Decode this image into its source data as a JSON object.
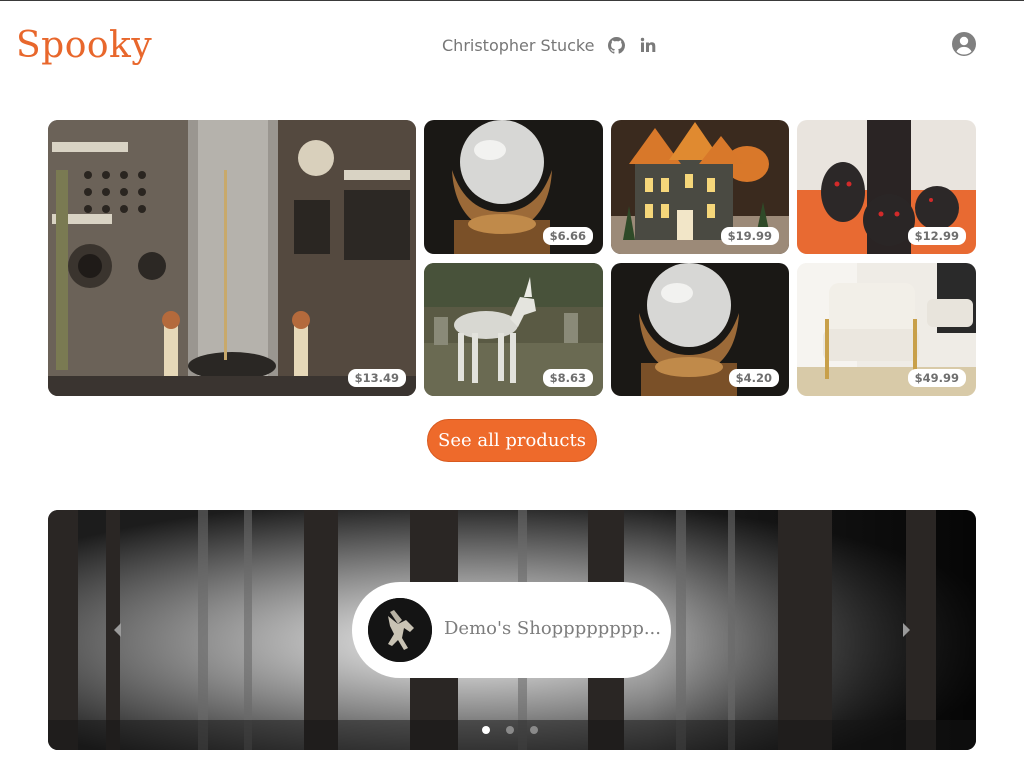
{
  "header": {
    "logo": "Spooky",
    "author_name": "Christopher Stucke",
    "github_icon": "github-icon",
    "linkedin_icon": "linkedin-icon",
    "account_icon": "user-circle-icon"
  },
  "products": [
    {
      "name": "electrical-machine",
      "price": "$13.49"
    },
    {
      "name": "crystal-ball",
      "price": "$6.66"
    },
    {
      "name": "haunted-house",
      "price": "$19.99"
    },
    {
      "name": "owl-figurines",
      "price": "$12.99"
    },
    {
      "name": "skeleton-unicorn",
      "price": "$8.63"
    },
    {
      "name": "crystal-ball-2",
      "price": "$4.20"
    },
    {
      "name": "lounge-chair",
      "price": "$49.99"
    }
  ],
  "cta": {
    "label": "See all products"
  },
  "carousel": {
    "shop_name": "Demo's Shopppppppp...",
    "prev_icon": "chevron-left-icon",
    "next_icon": "chevron-right-icon",
    "slides": 3,
    "active_slide": 1
  },
  "colors": {
    "brand": "#e8672c",
    "cta": "#ee6a2b",
    "text_muted": "#777777"
  }
}
